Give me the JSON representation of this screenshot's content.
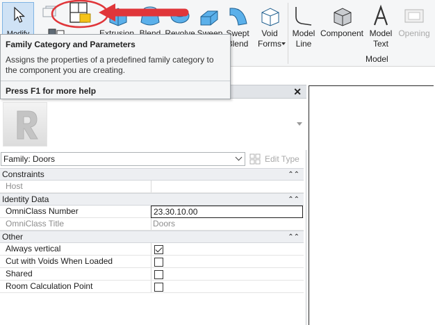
{
  "ribbon": {
    "buttons": {
      "modify": "Modify",
      "extrusion": "Extrusion",
      "blend": "Blend",
      "revolve": "Revolve",
      "sweep": "Sweep",
      "swept_blend_1": "Swept",
      "swept_blend_2": "Blend",
      "void_forms_1": "Void",
      "void_forms_2": "Forms",
      "model_line_1": "Model",
      "model_line_2": "Line",
      "component": "Component",
      "model_text_1": "Model",
      "model_text_2": "Text",
      "opening": "Opening"
    },
    "panel_model": "Model"
  },
  "tooltip": {
    "title": "Family Category and Parameters",
    "description": "Assigns the properties of a predefined family category to the component you are creating.",
    "help": "Press F1 for more help"
  },
  "properties": {
    "close_glyph": "✕",
    "family_selector": "Family: Doors",
    "edit_type": "Edit Type",
    "groups": {
      "constraints": "Constraints",
      "identity": "Identity Data",
      "other": "Other"
    },
    "collapse_glyph": "⌃⌃",
    "rows": {
      "host_label": "Host",
      "host_value": "",
      "omniclass_number_label": "OmniClass Number",
      "omniclass_number_value": "23.30.10.00",
      "omniclass_title_label": "OmniClass Title",
      "omniclass_title_value": "Doors",
      "always_vertical_label": "Always vertical",
      "always_vertical_checked": true,
      "cut_with_voids_label": "Cut with Voids When Loaded",
      "cut_with_voids_checked": false,
      "shared_label": "Shared",
      "shared_checked": false,
      "room_calc_label": "Room Calculation Point",
      "room_calc_checked": false
    }
  },
  "colors": {
    "annotation_red": "#e0363a",
    "modify_highlight": "#cfe2f5",
    "icon_blue": "#2d8fd5"
  }
}
